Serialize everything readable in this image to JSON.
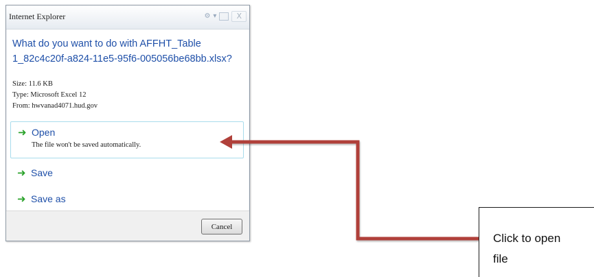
{
  "dialog": {
    "title": "Internet Explorer",
    "question": "What do you want to do with AFFHT_Table 1_82c4c20f-a824-11e5-95f6-005056be68bb.xlsx?",
    "size": "Size: 11.6 KB",
    "type": "Type: Microsoft Excel 12",
    "from": "From: hwvanad4071.hud.gov",
    "actions": [
      {
        "label": "Open",
        "sub": "The file won't be saved automatically."
      },
      {
        "label": "Save"
      },
      {
        "label": "Save as"
      }
    ],
    "cancel_label": "Cancel",
    "close_glyph": "X"
  },
  "callout": {
    "text": "Click to open file"
  },
  "colors": {
    "link_blue": "#1e4fa8",
    "arrow_green": "#2aa22a",
    "connector_red": "#b0403a"
  },
  "icons": {
    "action_arrow": "green-right-arrow-icon"
  }
}
